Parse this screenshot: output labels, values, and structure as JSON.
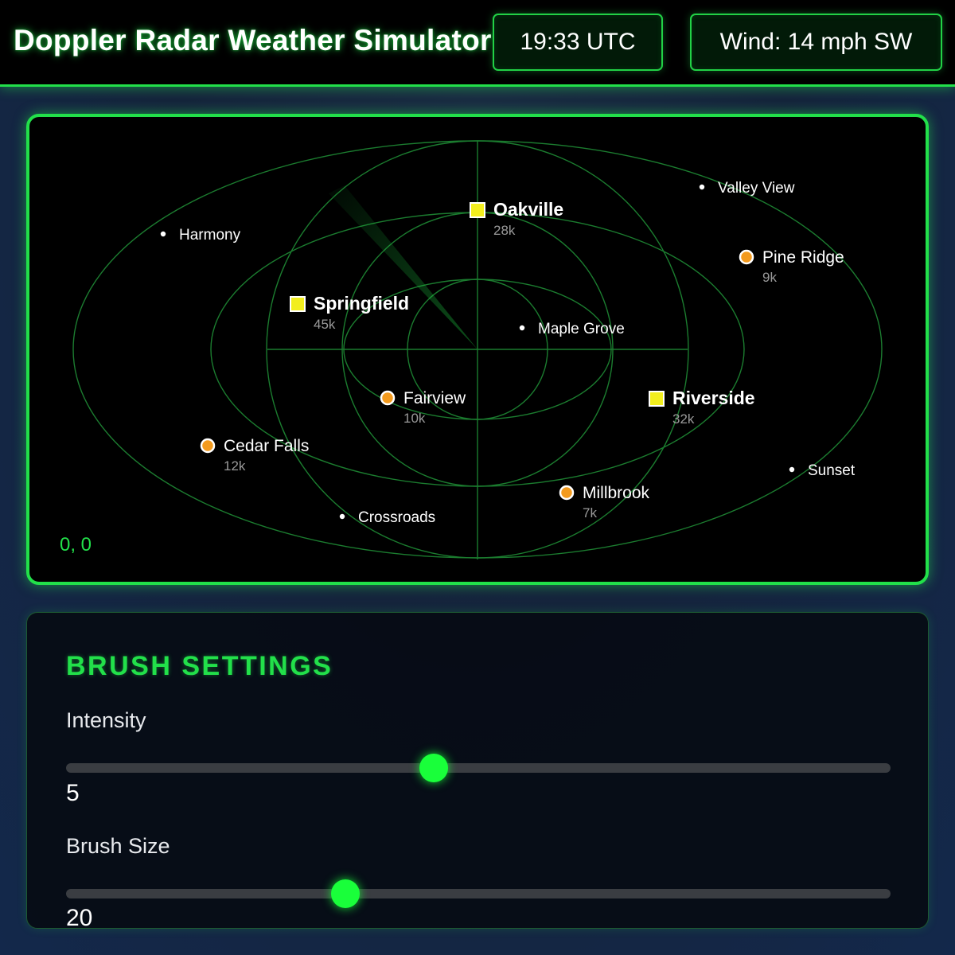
{
  "header": {
    "title": "Doppler Radar Weather Simulator",
    "time": "19:33 UTC",
    "wind": "Wind: 14 mph SW"
  },
  "radar": {
    "coordinates": "0, 0",
    "cities": [
      {
        "name": "Oakville",
        "pop": "28k",
        "kind": "major"
      },
      {
        "name": "Springfield",
        "pop": "45k",
        "kind": "major"
      },
      {
        "name": "Riverside",
        "pop": "32k",
        "kind": "major"
      },
      {
        "name": "Pine Ridge",
        "pop": "9k",
        "kind": "town"
      },
      {
        "name": "Fairview",
        "pop": "10k",
        "kind": "town"
      },
      {
        "name": "Cedar Falls",
        "pop": "12k",
        "kind": "town"
      },
      {
        "name": "Millbrook",
        "pop": "7k",
        "kind": "town"
      },
      {
        "name": "Valley View",
        "pop": "",
        "kind": "village"
      },
      {
        "name": "Harmony",
        "pop": "",
        "kind": "village"
      },
      {
        "name": "Maple Grove",
        "pop": "",
        "kind": "village"
      },
      {
        "name": "Sunset",
        "pop": "",
        "kind": "village"
      },
      {
        "name": "Crossroads",
        "pop": "",
        "kind": "village"
      }
    ],
    "colors": {
      "grid": "#1f8a35",
      "major": "#f2ee1e",
      "town": "#f39a1d",
      "village": "#ffffff"
    }
  },
  "brush": {
    "title": "BRUSH SETTINGS",
    "intensity": {
      "label": "Intensity",
      "value": "5",
      "fraction": 0.446
    },
    "size": {
      "label": "Brush Size",
      "value": "20",
      "fraction": 0.339
    }
  },
  "colors": {
    "accent": "#22e04a",
    "thumb": "#19ff3a"
  }
}
